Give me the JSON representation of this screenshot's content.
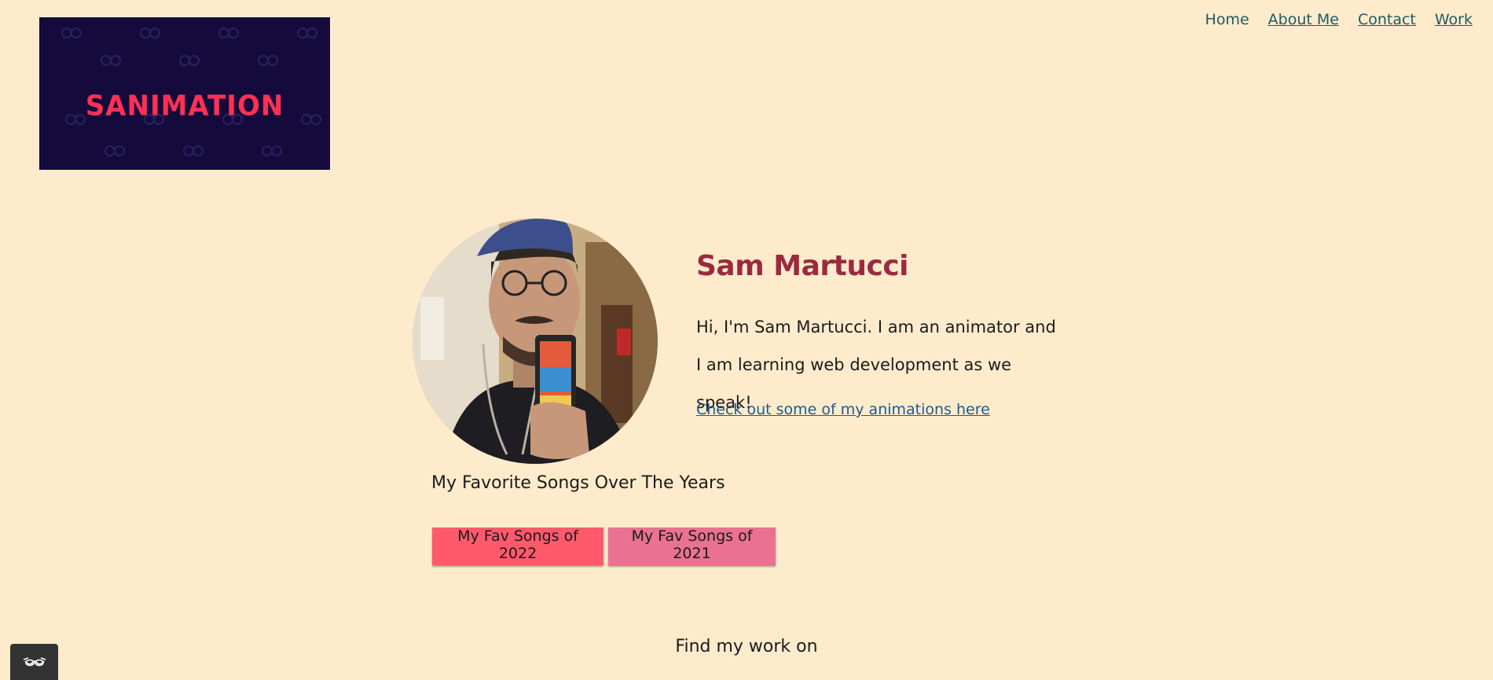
{
  "logo": {
    "text": "SANIMATION",
    "bg_color": "#140b3c",
    "text_color": "#ff3054"
  },
  "nav": {
    "items": [
      {
        "label": "Home"
      },
      {
        "label": "About Me"
      },
      {
        "label": "Contact"
      },
      {
        "label": "Work"
      }
    ]
  },
  "profile": {
    "name": "Sam Martucci",
    "bio": "Hi, I'm Sam Martucci. I am an animator and I am learning web development as we speak!",
    "link_text": "Check out some of my animations here",
    "photo_icon": "profile-photo"
  },
  "songs": {
    "heading": "My Favorite Songs Over The Years",
    "buttons": [
      {
        "label": "My Fav Songs of 2022",
        "color": "#ff5a6c"
      },
      {
        "label": "My Fav Songs of 2021",
        "color": "#ea7192"
      }
    ]
  },
  "footer": {
    "heading": "Find my work on"
  },
  "accessibility": {
    "icon": "glasses-icon"
  },
  "colors": {
    "background": "#feebcc",
    "name": "#9b2a3f",
    "nav_link": "#1e5a66"
  }
}
